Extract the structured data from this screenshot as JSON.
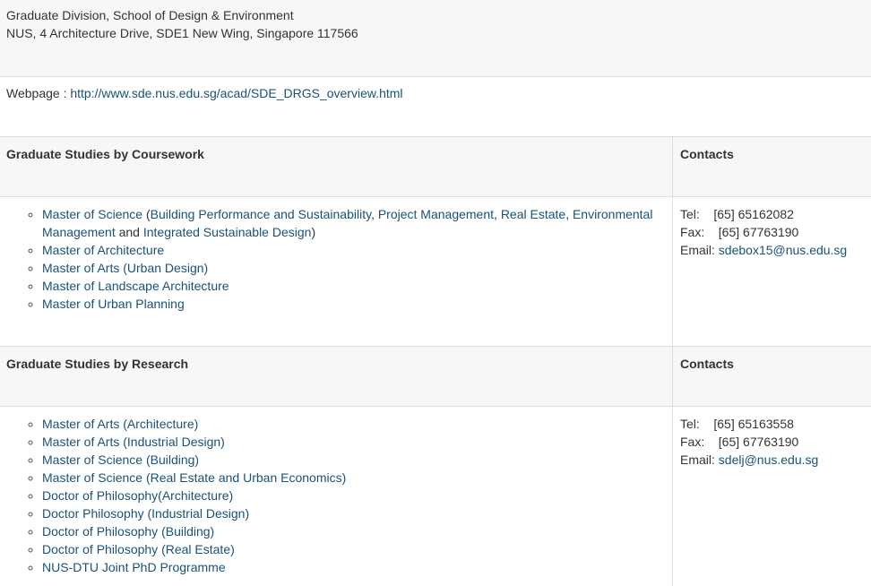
{
  "address": {
    "line1": "Graduate Division, School of Design & Environment",
    "line2": "NUS, 4 Architecture Drive, SDE1 New Wing, Singapore 117566"
  },
  "webpage": {
    "label": "Webpage : ",
    "url": "http://www.sde.nus.edu.sg/acad/SDE_DRGS_overview.html"
  },
  "coursework": {
    "title": "Graduate Studies by Coursework",
    "contacts_title": "Contacts",
    "items": {
      "msc_prefix": "Master of Science",
      "msc_paren_open": " (",
      "msc_bps": "Building Performance and Sustainability",
      "msc_sep1": ", ",
      "msc_pm": "Project Management",
      "msc_sep2": ", ",
      "msc_re": "Real Estate",
      "msc_sep3": ", ",
      "msc_em": "Environmental Management",
      "msc_and": " and ",
      "msc_isd": "Integrated Sustainable Design",
      "msc_paren_close": ")",
      "march": "Master of Architecture",
      "ma_ud": "Master of Arts (Urban Design)",
      "mla": "Master of Landscape Architecture",
      "mup": "Master of Urban Planning"
    },
    "contact": {
      "tel_label": "Tel:",
      "tel": "[65] 65162082",
      "fax_label": "Fax:",
      "fax": "[65] 67763190",
      "email_label": "Email:",
      "email": "sdebox15@nus.edu.sg"
    }
  },
  "research": {
    "title": "Graduate Studies by Research",
    "contacts_title": "Contacts",
    "items": [
      "Master of Arts (Architecture)",
      "Master of Arts (Industrial Design)",
      "Master of Science (Building)",
      "Master of Science (Real Estate and Urban Economics)",
      "Doctor of Philosophy(Architecture)",
      "Doctor Philosophy (Industrial Design)",
      "Doctor of Philosophy (Building)",
      "Doctor of Philosophy (Real Estate)",
      "NUS-DTU Joint PhD Programme"
    ],
    "contact": {
      "tel_label": "Tel:",
      "tel": "[65] 65163558",
      "fax_label": "Fax:",
      "fax": "[65] 67763190",
      "email_label": "Email:",
      "email": "sdelj@nus.edu.sg"
    }
  },
  "colors": {
    "link": "#1a5276",
    "row_gray": "#f7f7f7",
    "border": "#dddddd"
  }
}
